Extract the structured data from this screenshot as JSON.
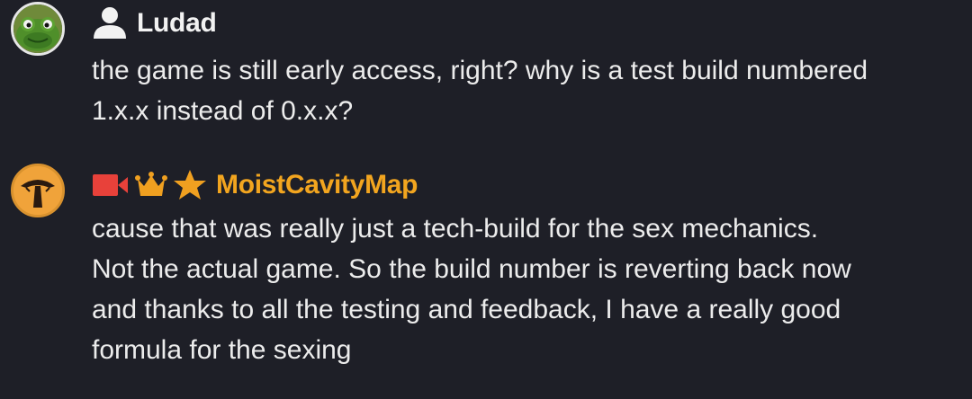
{
  "messages": [
    {
      "username": "Ludad",
      "avatar": "frog-avatar",
      "badges": [
        "user-icon"
      ],
      "text": "the game is still early access, right? why is a test build numbered\n1.x.x instead of 0.x.x?"
    },
    {
      "username": "MoistCavityMap",
      "avatar": "mushroom-logo-avatar",
      "badges": [
        "video-camera-icon",
        "crown-icon",
        "star-icon"
      ],
      "text": "cause that was really just a tech-build for the sex mechanics.\nNot the actual game. So the build number is reverting back now\nand thanks to all the testing and feedback, I have a really good\nformula for the sexing"
    }
  ],
  "colors": {
    "background": "#1e1f27",
    "text": "#ececec",
    "highlight_username": "#f2a51f",
    "video_badge": "#e8413a",
    "crown_badge": "#f0a020",
    "star_badge": "#f0a020"
  }
}
